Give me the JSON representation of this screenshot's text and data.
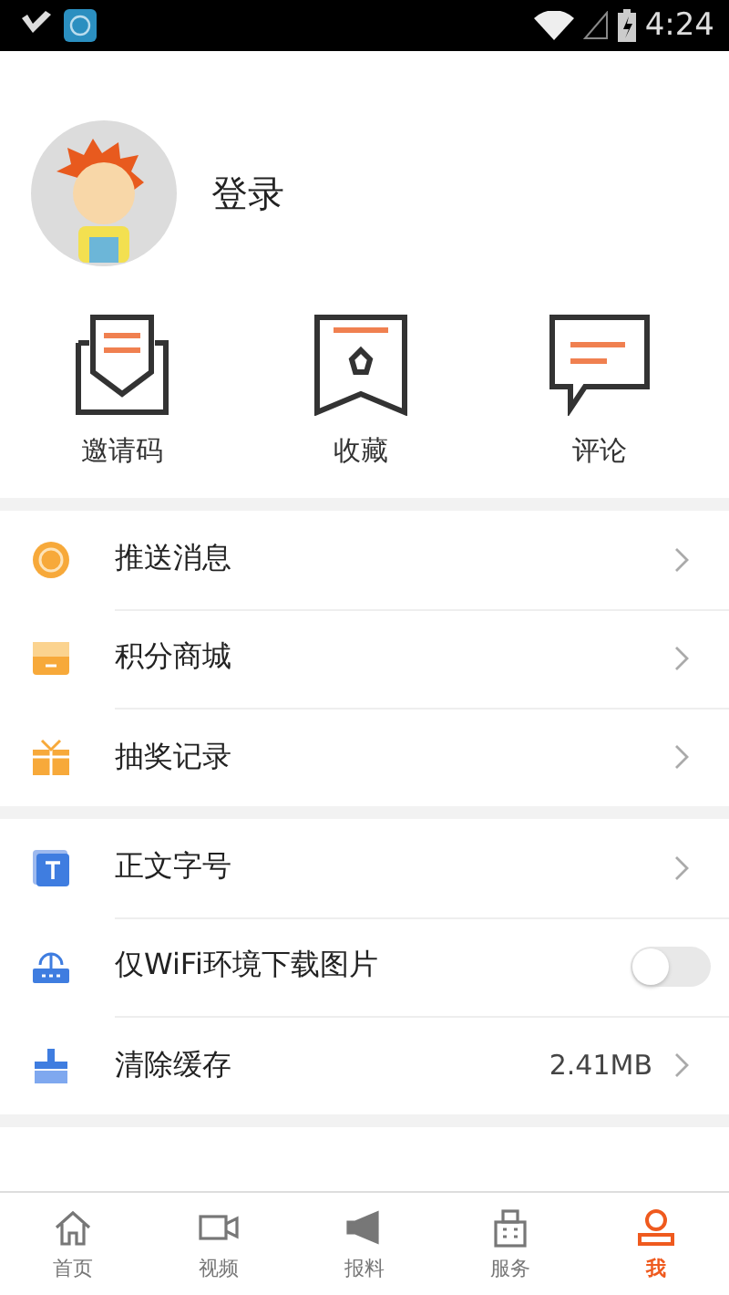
{
  "status_bar": {
    "time": "4:24"
  },
  "profile": {
    "login_label": "登录"
  },
  "shortcuts": [
    {
      "label": "邀请码"
    },
    {
      "label": "收藏"
    },
    {
      "label": "评论"
    }
  ],
  "menu_groups": [
    {
      "items": [
        {
          "kind": "chevron",
          "label": "推送消息"
        },
        {
          "kind": "chevron",
          "label": "积分商城"
        },
        {
          "kind": "chevron",
          "label": "抽奖记录"
        }
      ]
    },
    {
      "items": [
        {
          "kind": "chevron",
          "label": "正文字号"
        },
        {
          "kind": "toggle",
          "label": "仅WiFi环境下载图片",
          "on": false
        },
        {
          "kind": "value",
          "label": "清除缓存",
          "value": "2.41MB"
        }
      ]
    }
  ],
  "bottom_nav": [
    {
      "label": "首页",
      "selected": false
    },
    {
      "label": "视频",
      "selected": false
    },
    {
      "label": "报料",
      "selected": false
    },
    {
      "label": "服务",
      "selected": false
    },
    {
      "label": "我",
      "selected": true
    }
  ]
}
